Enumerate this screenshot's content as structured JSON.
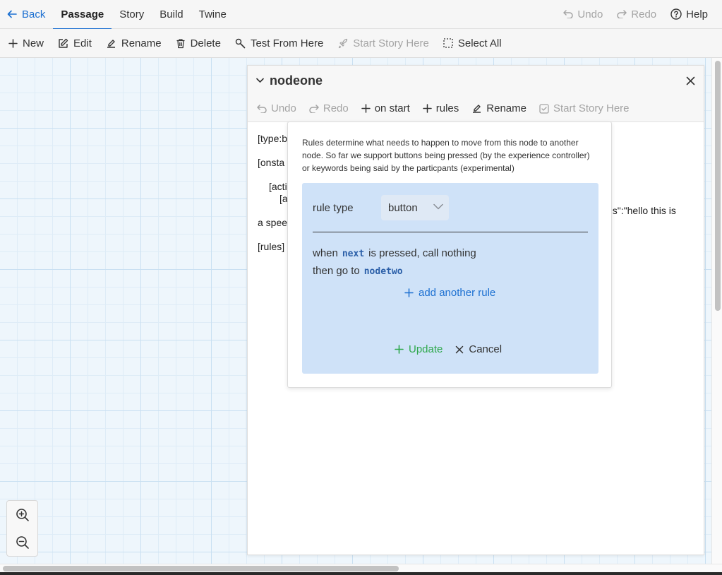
{
  "topnav": {
    "back_label": "Back",
    "tabs": [
      {
        "label": "Passage",
        "active": true
      },
      {
        "label": "Story",
        "active": false
      },
      {
        "label": "Build",
        "active": false
      },
      {
        "label": "Twine",
        "active": false
      }
    ],
    "undo_label": "Undo",
    "redo_label": "Redo",
    "help_label": "Help"
  },
  "toolbar": {
    "new_label": "New",
    "edit_label": "Edit",
    "rename_label": "Rename",
    "delete_label": "Delete",
    "test_label": "Test From Here",
    "start_label": "Start Story Here",
    "select_all_label": "Select All"
  },
  "dialog": {
    "title": "nodeone",
    "tools": {
      "undo_label": "Undo",
      "redo_label": "Redo",
      "on_start_label": "on start",
      "rules_label": "rules",
      "rename_label": "Rename",
      "start_label": "Start Story Here"
    },
    "passage_lines": [
      "[type:b",
      "[onsta",
      "[acti",
      "[a",
      "ds\":\"hello this is",
      "a spee",
      "[rules]"
    ]
  },
  "popover": {
    "description": "Rules determine what needs to happen to move from this node to another node. So far we support buttons being pressed (by the experience controller) or keywords being said by the particpants (experimental)",
    "rule_type_label": "rule type",
    "rule_type_value": "button",
    "when_prefix": "when",
    "button_name": "next",
    "when_suffix": "is pressed, call nothing",
    "then_prefix": "then go to",
    "target_node": "nodetwo",
    "add_rule_label": "add another rule",
    "update_label": "Update",
    "cancel_label": "Cancel"
  },
  "colors": {
    "accent": "#1b6fd1",
    "success": "#2ea84c",
    "rule_panel_bg": "#cfe2f8",
    "canvas_bg": "#eef6fc",
    "disabled_text": "#a4a4a4"
  },
  "scroll": {
    "vertical_fraction": 0.49,
    "horizontal_fraction": 0.55
  }
}
